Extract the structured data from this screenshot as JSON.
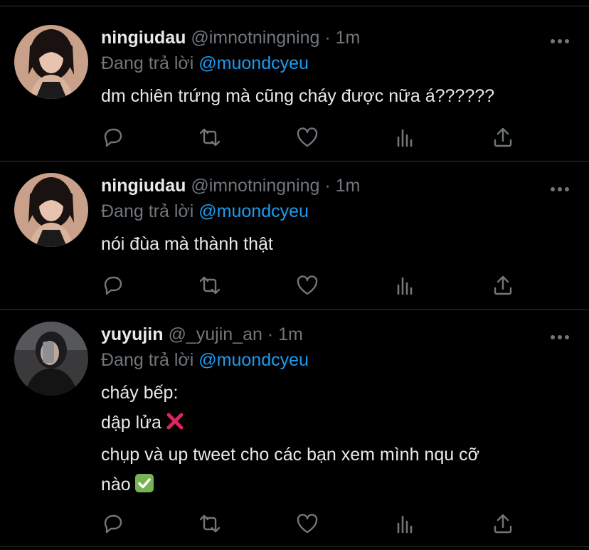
{
  "tweets": [
    {
      "name": "ningiudau",
      "handle": "@imnotningning",
      "separator": "·",
      "time": "1m",
      "reply_prefix": "Đang trả lời",
      "reply_to": "@muondcyeu",
      "lines": [
        "dm chiên trứng mà cũng cháy được nữa á??????"
      ]
    },
    {
      "name": "ningiudau",
      "handle": "@imnotningning",
      "separator": "·",
      "time": "1m",
      "reply_prefix": "Đang trả lời",
      "reply_to": "@muondcyeu",
      "lines": [
        "nói đùa mà thành thật"
      ]
    },
    {
      "name": "yuyujin",
      "handle": "@_yujin_an",
      "separator": "·",
      "time": "1m",
      "reply_prefix": "Đang trả lời",
      "reply_to": "@muondcyeu",
      "lines": [
        "cháy bếp:",
        "dập lửa",
        "chụp và up tweet cho các bạn xem mình nqu cỡ",
        "nào"
      ]
    }
  ],
  "icons": {
    "reply": "reply-icon",
    "retweet": "retweet-icon",
    "like": "heart-icon",
    "views": "analytics-icon",
    "share": "share-icon",
    "more": "more-icon",
    "cross_emoji": "cross-mark-emoji",
    "check_emoji": "check-mark-emoji"
  },
  "colors": {
    "background": "#000000",
    "text": "#e7e9ea",
    "secondary": "#71767b",
    "link": "#1d9bf0",
    "divider": "#2f3336"
  }
}
